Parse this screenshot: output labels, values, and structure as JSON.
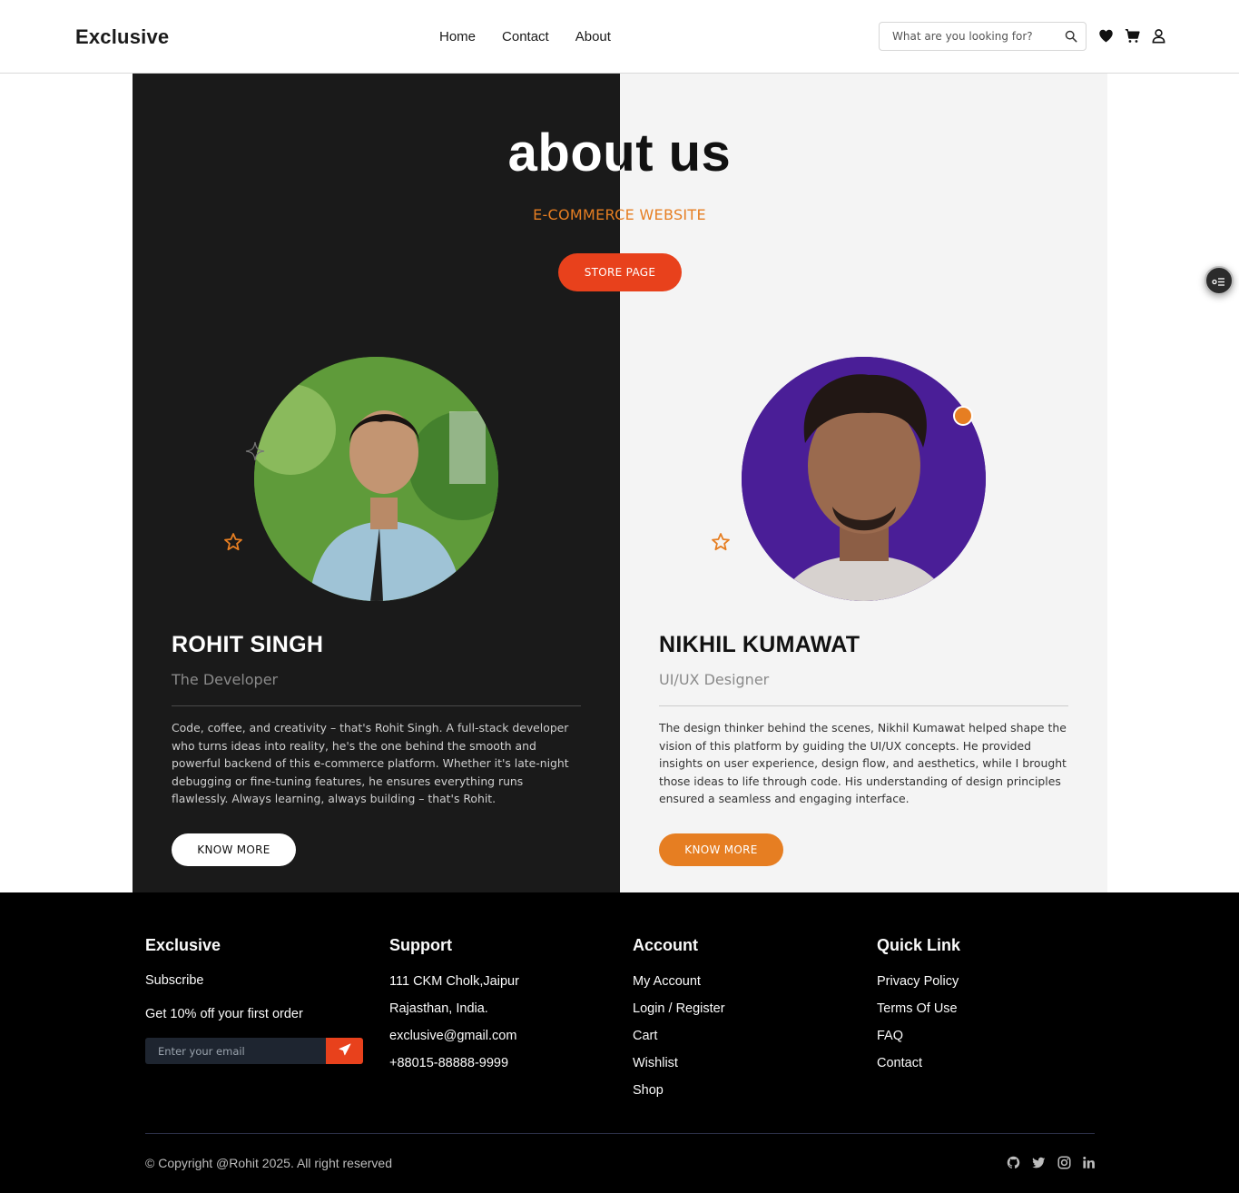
{
  "header": {
    "logo": "Exclusive",
    "nav": [
      "Home",
      "Contact",
      "About"
    ],
    "search_placeholder": "What are you looking for?",
    "icons": [
      "search-icon",
      "heart-icon",
      "cart-icon",
      "user-icon"
    ]
  },
  "hero": {
    "title": "about us",
    "subtitle": "E-COMMERCE WEBSITE",
    "store_button": "STORE PAGE"
  },
  "team": [
    {
      "name": "ROHIT SINGH",
      "role": "The Developer",
      "bio": "Code, coffee, and creativity – that's Rohit Singh. A full-stack developer who turns ideas into reality, he's the one behind the smooth and powerful backend of this e-commerce platform. Whether it's late-night debugging or fine-tuning features, he ensures everything runs flawlessly. Always learning, always building – that's Rohit.",
      "button": "KNOW MORE"
    },
    {
      "name": "NIKHIL KUMAWAT",
      "role": "UI/UX Designer",
      "bio": "The design thinker behind the scenes, Nikhil Kumawat helped shape the vision of this platform by guiding the UI/UX concepts. He provided insights on user experience, design flow, and aesthetics, while I brought those ideas to life through code. His understanding of design principles ensured a seamless and engaging interface.",
      "button": "KNOW MORE"
    }
  ],
  "footer": {
    "brand": {
      "title": "Exclusive",
      "subscribe": "Subscribe",
      "offer": "Get 10% off your first order",
      "email_placeholder": "Enter your email"
    },
    "support": {
      "title": "Support",
      "items": [
        "111 CKM Cholk,Jaipur",
        "Rajasthan, India.",
        "exclusive@gmail.com",
        "+88015-88888-9999"
      ]
    },
    "account": {
      "title": "Account",
      "items": [
        "My Account",
        "Login / Register",
        "Cart",
        "Wishlist",
        "Shop"
      ]
    },
    "quick_link": {
      "title": "Quick Link",
      "items": [
        "Privacy Policy",
        "Terms Of Use",
        "FAQ",
        "Contact"
      ]
    },
    "copyright": "© Copyright @Rohit 2025. All right reserved",
    "social_icons": [
      "github-icon",
      "twitter-icon",
      "instagram-icon",
      "linkedin-icon"
    ]
  },
  "colors": {
    "accent_orange": "#e67e22",
    "accent_red": "#e8411c",
    "dark_panel": "#1a1a1a",
    "light_panel": "#f4f4f4"
  }
}
